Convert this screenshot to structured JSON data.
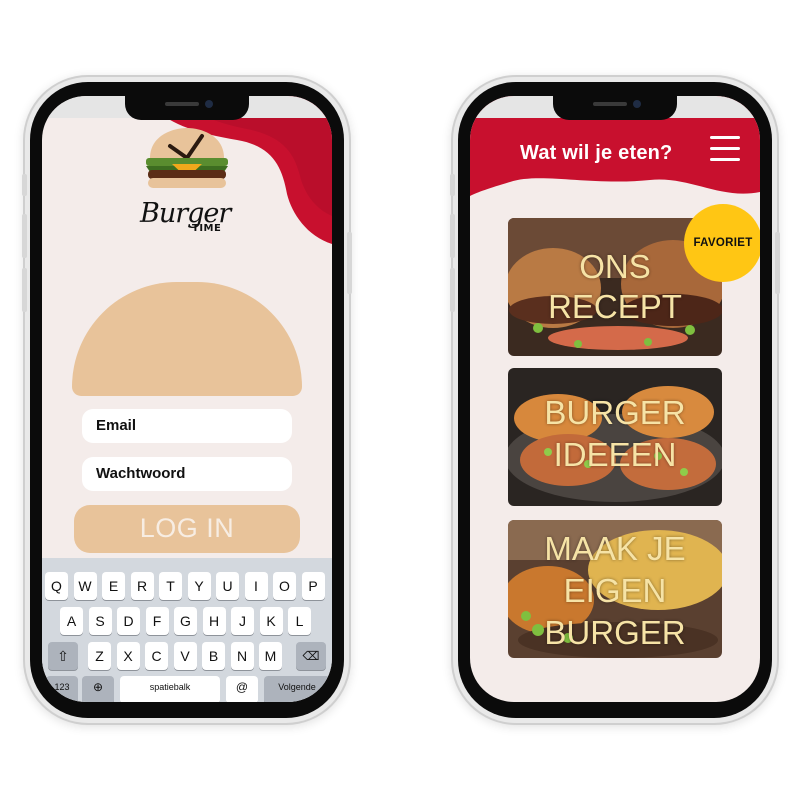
{
  "login_screen": {
    "brand_name": "Burger",
    "brand_sub": "TIME",
    "email_label": "Email",
    "password_label": "Wachtwoord",
    "login_button": "LOG IN",
    "keyboard": {
      "row1": [
        "Q",
        "W",
        "E",
        "R",
        "T",
        "Y",
        "U",
        "I",
        "O",
        "P"
      ],
      "row2": [
        "A",
        "S",
        "D",
        "F",
        "G",
        "H",
        "J",
        "K",
        "L"
      ],
      "row3": [
        "Z",
        "X",
        "C",
        "V",
        "B",
        "N",
        "M"
      ],
      "space_label": "spatiebalk",
      "next_label": "Volgende",
      "numbers_label": "123",
      "shift_icon": "shift-icon",
      "backspace_icon": "backspace-icon",
      "globe_icon": "globe-icon",
      "at_label": "@"
    },
    "colors": {
      "red": "#c8102e",
      "bun": "#e8c39a",
      "background": "#f4ecea"
    }
  },
  "menu_screen": {
    "header_title": "Wat wil je eten?",
    "menu_icon": "hamburger-menu-icon",
    "favorite_badge": "FAVORIET",
    "cards": [
      {
        "line1": "ONS",
        "line2": "RECEPT"
      },
      {
        "line1": "BURGER",
        "line2": "IDEEEN"
      },
      {
        "line1": "MAAK JE",
        "line2": "EIGEN",
        "line3": "BURGER"
      }
    ],
    "colors": {
      "red": "#c8102e",
      "badge": "#ffc614",
      "card_text": "#f6e3a6"
    }
  }
}
